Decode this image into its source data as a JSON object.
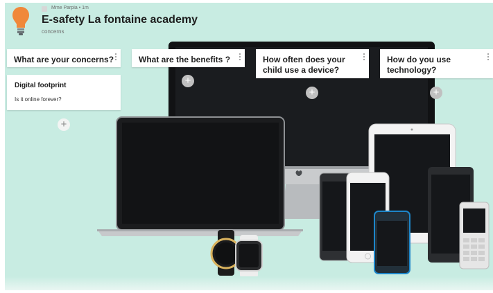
{
  "header": {
    "author": "Mme Parpia",
    "age": "1m",
    "title": "E-safety La fontaine academy",
    "subtitle": "concerns"
  },
  "columns": [
    {
      "label": "What are your concerns?"
    },
    {
      "label": "What are the benefits ?"
    },
    {
      "label": "How often does your child use a device?"
    },
    {
      "label": "How do you use technology?"
    }
  ],
  "posts": [
    {
      "title": "Digital footprint",
      "body": "Is it online forever?"
    }
  ],
  "add_symbol": "+",
  "colors": {
    "background": "#c8ece2",
    "card": "#ffffff",
    "bulb": "#f0883a",
    "device_screen": "#15171a"
  },
  "background_image": "devices-mockup"
}
